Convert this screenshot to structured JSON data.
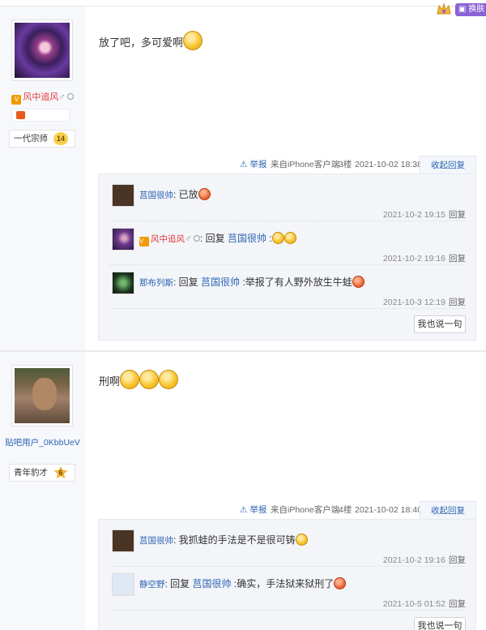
{
  "header": {
    "skin_label": "换肤"
  },
  "posts": [
    {
      "user": {
        "name": "风中追风",
        "level_title": "一代宗师",
        "level_num": "14"
      },
      "content": "放了吧，多可爱啊",
      "meta": {
        "report": "举报",
        "source": "来自iPhone客户端",
        "floor": "3楼",
        "date": "2021-10-02 18:38",
        "collapse": "收起回复"
      },
      "replies": [
        {
          "user": "莒国很帅",
          "text_parts": [
            ": 已放"
          ],
          "time": "2021-10-2 19:15",
          "reply_label": "回复"
        },
        {
          "user": "风中追风",
          "text_parts": [
            ": 回复 ",
            "莒国很帅",
            " :"
          ],
          "time": "2021-10-2 19:16",
          "reply_label": "回复"
        },
        {
          "user": "那布列斯",
          "text_parts": [
            ": 回复 ",
            "莒国很帅",
            " :举报了有人野外放生牛蛙"
          ],
          "time": "2021-10-3 12:19",
          "reply_label": "回复"
        }
      ],
      "say_button": "我也说一句"
    },
    {
      "user": {
        "name": "贴吧用户_0KbbUeV",
        "level_title": "青年豹才",
        "level_num": "6"
      },
      "content": "刑啊",
      "meta": {
        "report": "举报",
        "source": "来自iPhone客户端",
        "floor": "4楼",
        "date": "2021-10-02 18:40",
        "collapse": "收起回复"
      },
      "replies": [
        {
          "user": "莒国很帅",
          "text_parts": [
            ": 我抓蛙的手法是不是很可铸"
          ],
          "time": "2021-10-2 19:16",
          "reply_label": "回复"
        },
        {
          "user": "静空野",
          "text_parts": [
            ": 回复 ",
            "莒国很帅",
            " :确实，手法狱来狱刑了"
          ],
          "time": "2021-10-5 01:52",
          "reply_label": "回复"
        }
      ],
      "say_button": "我也说一句"
    }
  ]
}
